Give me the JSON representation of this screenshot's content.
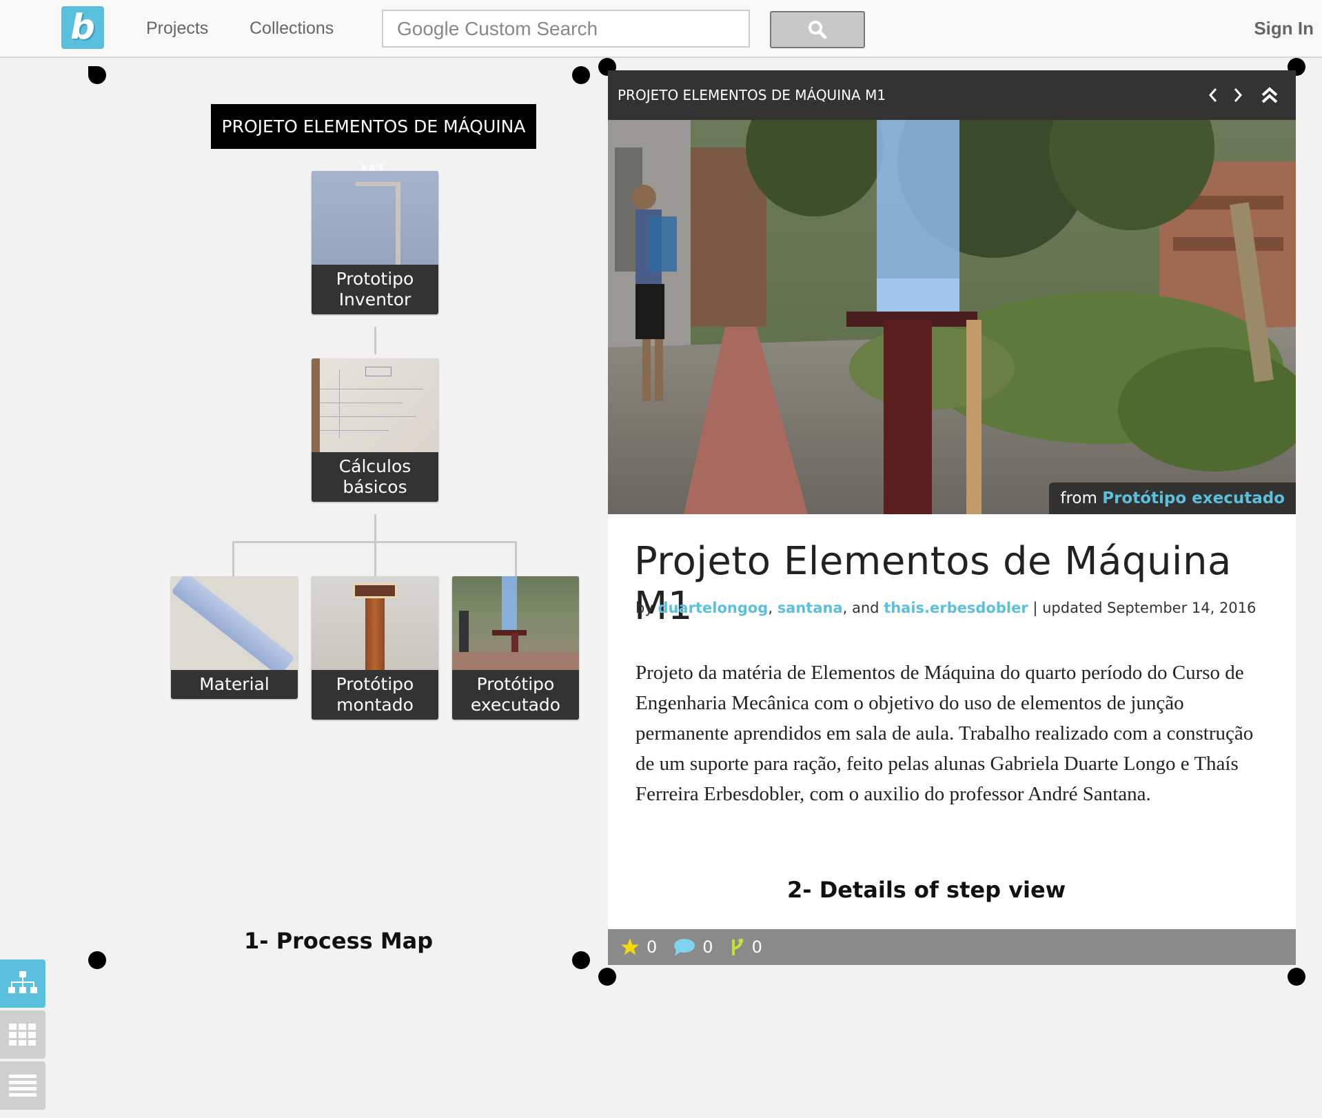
{
  "nav": {
    "logo_text": "b",
    "projects": "Projects",
    "collections": "Collections",
    "search_placeholder": "Google Custom Search",
    "sign_in": "Sign In"
  },
  "map": {
    "project_title": "PROJETO ELEMENTOS DE MÁQUINA M1",
    "nodes": [
      {
        "label": "Prototipo Inventor"
      },
      {
        "label": "Cálculos básicos"
      },
      {
        "label": "Material"
      },
      {
        "label": "Protótipo montado"
      },
      {
        "label": "Protótipo executado"
      }
    ],
    "caption": "1- Process Map"
  },
  "detail": {
    "header_title": "PROJETO ELEMENTOS DE MÁQUINA M1",
    "from_prefix": "from",
    "from_step": "Protótipo executado",
    "title": "Projeto Elementos de Máquina M1",
    "by": "by",
    "authors": [
      "duartelongog",
      "santana",
      "thais.erbesdobler"
    ],
    "sep_comma": ",",
    "and": ", and",
    "updated": "| updated September 14, 2016",
    "body": "Projeto da matéria de Elementos de Máquina do quarto período do Curso de Engenharia Mecânica com o objetivo do uso de elementos de junção permanente aprendidos em sala de aula. Trabalho realizado com a construção de um suporte para ração, feito pelas alunas Gabriela Duarte Longo e Thaís Ferreira Erbesdobler, com o auxilio do professor André Santana.",
    "caption": "2- Details of step view",
    "stats": {
      "stars": "0",
      "comments": "0",
      "branches": "0"
    }
  },
  "colors": {
    "accent": "#5bc0de",
    "header_dark": "#333333",
    "footer_gray": "#8a8a8a"
  },
  "icons": [
    "logo-icon",
    "search-icon",
    "chevron-left-icon",
    "chevron-right-icon",
    "double-chevron-up-icon",
    "star-icon",
    "comment-icon",
    "branch-icon",
    "tree-view-icon",
    "grid-view-icon",
    "list-view-icon"
  ]
}
